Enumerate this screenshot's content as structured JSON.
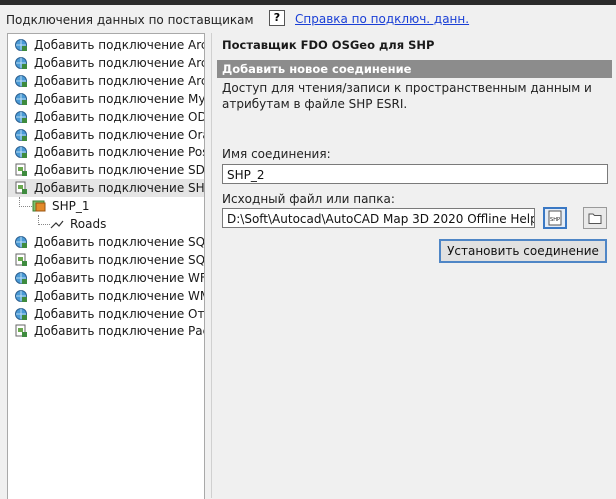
{
  "header": {
    "panel_title": "Подключения данных по поставщикам",
    "help_icon_glyph": "?",
    "help_link": "Справка по подключ. данн."
  },
  "tree": {
    "items": [
      {
        "label": "Добавить подключение ArcGIS",
        "icon": "plug-globe-icon"
      },
      {
        "label": "Добавить подключение ArcGIS",
        "icon": "plug-globe-icon"
      },
      {
        "label": "Добавить подключение ArcSDE",
        "icon": "plug-globe-icon"
      },
      {
        "label": "Добавить подключение MySQL",
        "icon": "plug-globe-icon"
      },
      {
        "label": "Добавить подключение ODBC",
        "icon": "plug-globe-icon"
      },
      {
        "label": "Добавить подключение Oracle",
        "icon": "plug-globe-icon"
      },
      {
        "label": "Добавить подключение Postgr",
        "icon": "plug-globe-icon"
      },
      {
        "label": "Добавить подключение SDF",
        "icon": "plug-file-icon"
      },
      {
        "label": "Добавить подключение SHP",
        "icon": "plug-file-icon"
      },
      {
        "label": "SHP_1",
        "icon": "shp-layer-icon"
      },
      {
        "label": "Roads",
        "icon": "polyline-icon"
      },
      {
        "label": "Добавить подключение SQL Se",
        "icon": "plug-globe-icon"
      },
      {
        "label": "Добавить подключение SQLite",
        "icon": "plug-file-icon"
      },
      {
        "label": "Добавить подключение WFS",
        "icon": "plug-globe-icon"
      },
      {
        "label": "Добавить подключение WMS",
        "icon": "plug-globe-icon"
      },
      {
        "label": "Добавить подключение Отрас.",
        "icon": "plug-globe-icon"
      },
      {
        "label": "Добавить подключение Растро",
        "icon": "plug-file-icon"
      }
    ],
    "selected_index": 8
  },
  "right": {
    "provider_title": "Поставщик FDO OSGeo для SHP",
    "section_title": "Добавить новое соединение",
    "description": "Доступ для чтения/записи к пространственным данным и атрибутам в файле SHP ESRI.",
    "connection_name_label": "Имя соединения:",
    "connection_name_value": "SHP_2",
    "source_label": "Исходный файл или папка:",
    "source_value": "D:\\Soft\\Autocad\\AutoCAD Map 3D 2020 Offline Help\\Russ",
    "shp_button_text": "SHP",
    "connect_button": "Установить соединение"
  },
  "colors": {
    "section_bar": "#8c8c8c",
    "link": "#1a3fd6",
    "accent_border": "#4f86c6"
  }
}
